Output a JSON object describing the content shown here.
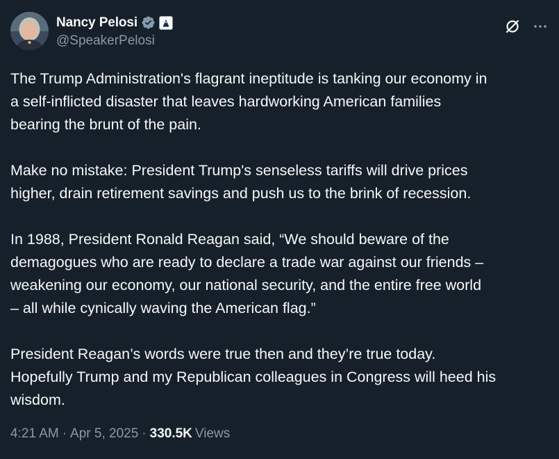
{
  "author": {
    "display_name": "Nancy Pelosi",
    "handle": "@SpeakerPelosi",
    "avatar_icon": "profile-photo",
    "verified_icon": "verified-badge-icon",
    "affiliation_icon": "us-government-badge-icon"
  },
  "actions": {
    "grok_icon": "grok-icon",
    "more_icon": "more-options-icon"
  },
  "tweet": {
    "paragraphs": [
      "The Trump Administration's flagrant ineptitude is tanking our economy in\na self-inflicted disaster that leaves hardworking American families\nbearing the brunt of the pain.",
      "Make no mistake: President Trump's senseless tariffs will drive prices\nhigher, drain retirement savings and push us to the brink of recession.",
      "In 1988, President Ronald Reagan said, “We should beware of the\ndemagogues who are ready to declare a trade war against our friends –\nweakening our economy, our national security, and the entire free world\n– all while cynically waving the American flag.”",
      "President Reagan’s words were true then and they’re true today.\nHopefully Trump and my Republican colleagues in Congress will heed his\nwisdom."
    ]
  },
  "meta": {
    "time": "4:21 AM",
    "date": "Apr 5, 2025",
    "views_count": "330.5K",
    "views_label": "Views"
  },
  "colors": {
    "background": "#15202b",
    "text_primary": "#f7f9f9",
    "text_secondary": "#8b98a5",
    "verified_blue": "#1d9bf0"
  }
}
